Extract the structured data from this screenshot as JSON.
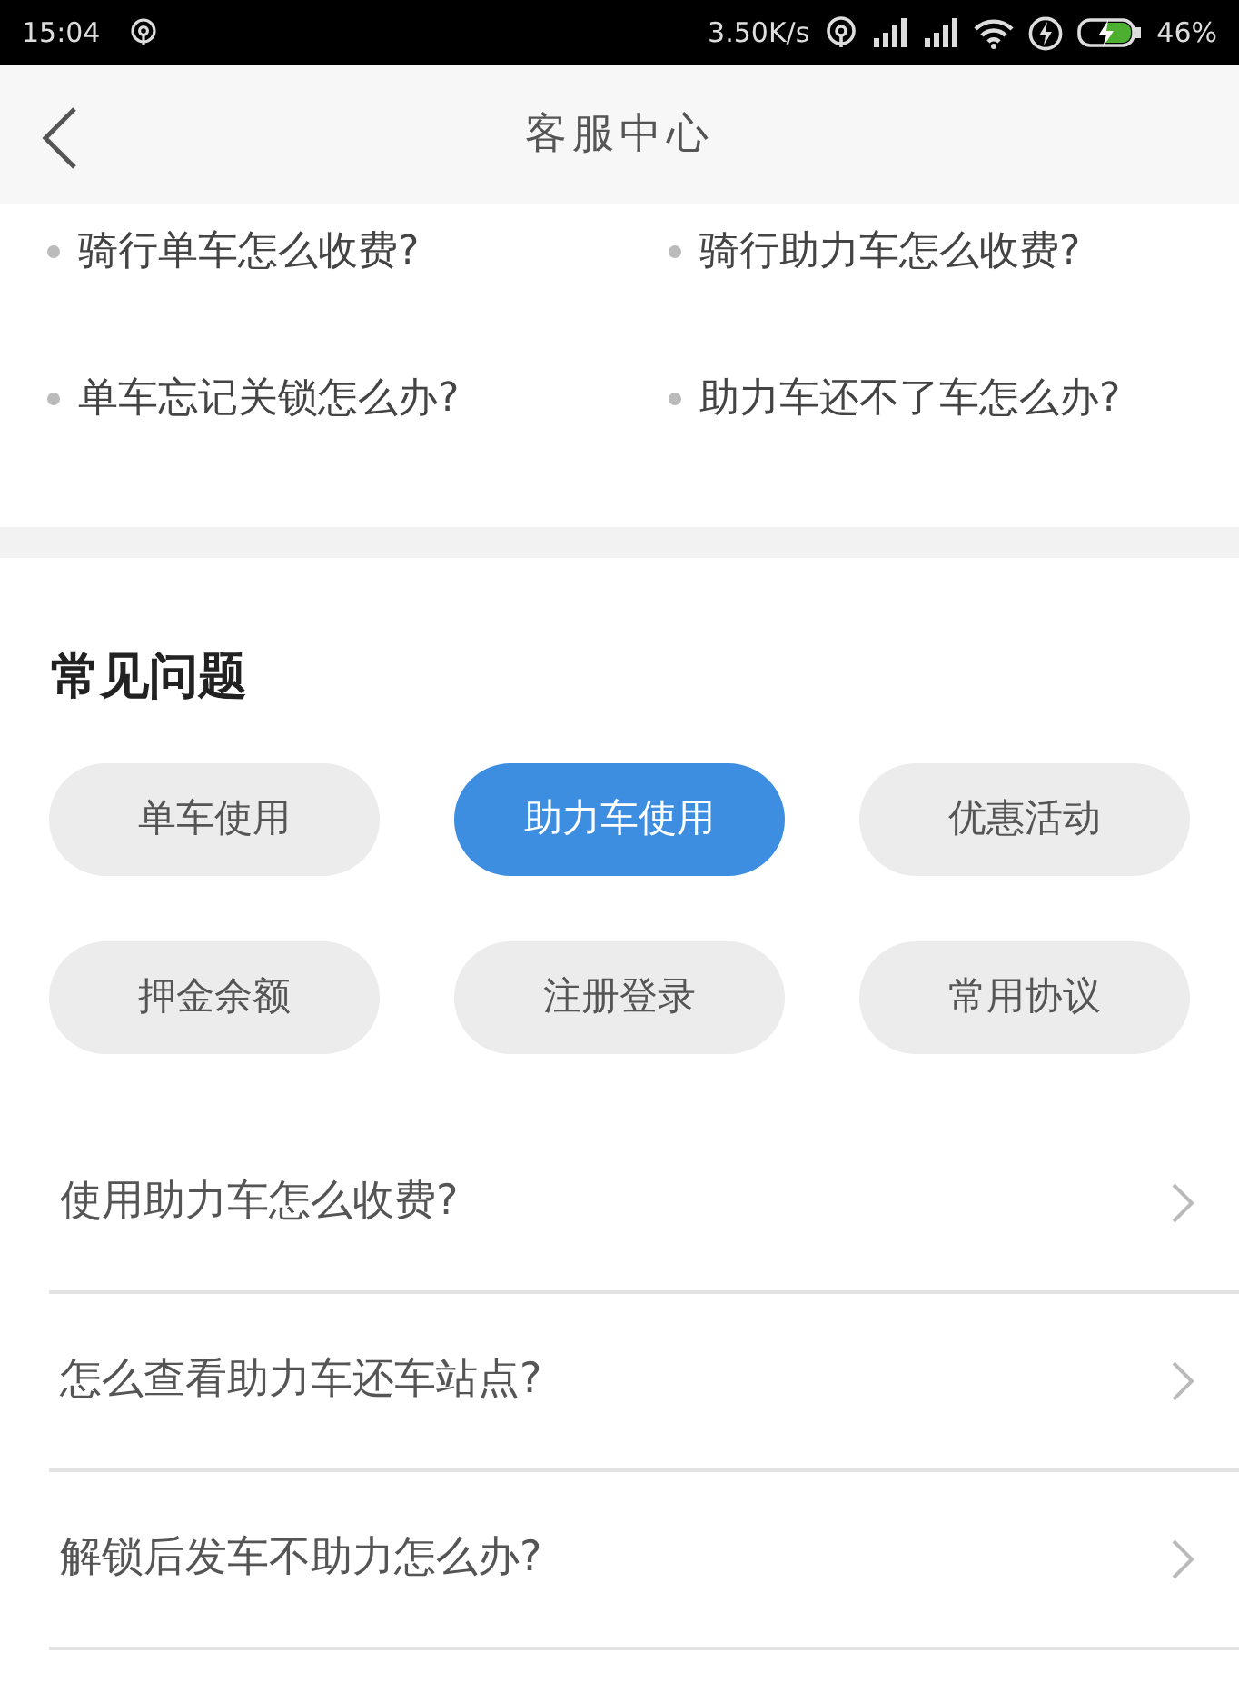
{
  "status_bar": {
    "time": "15:04",
    "speed": "3.50K/s",
    "battery": "46%"
  },
  "header": {
    "title": "客服中心"
  },
  "hot_questions": [
    "骑行单车怎么收费?",
    "骑行助力车怎么收费?",
    "单车忘记关锁怎么办?",
    "助力车还不了车怎么办?"
  ],
  "faq": {
    "title": "常见问题",
    "categories": [
      {
        "label": "单车使用",
        "selected": false
      },
      {
        "label": "助力车使用",
        "selected": true
      },
      {
        "label": "优惠活动",
        "selected": false
      },
      {
        "label": "押金余额",
        "selected": false
      },
      {
        "label": "注册登录",
        "selected": false
      },
      {
        "label": "常用协议",
        "selected": false
      }
    ],
    "questions": [
      "使用助力车怎么收费?",
      "怎么查看助力车还车站点?",
      "解锁后发车不助力怎么办?"
    ]
  }
}
